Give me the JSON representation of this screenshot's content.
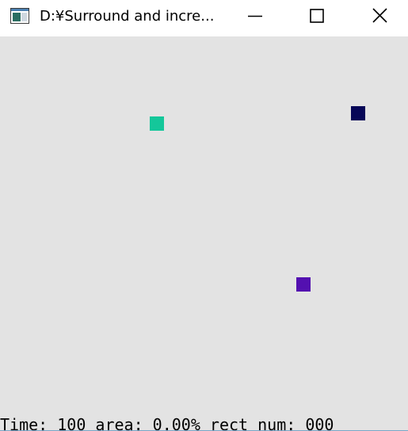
{
  "window": {
    "title": "D:¥Surround and incre..."
  },
  "icons": {
    "app": "app-window-icon",
    "minimize": "minimize-icon",
    "maximize": "maximize-icon",
    "close": "close-icon"
  },
  "canvas": {
    "background": "#e3e3e3",
    "squares": [
      {
        "color": "#14c79a"
      },
      {
        "color": "#070757"
      },
      {
        "color": "#5310b0"
      }
    ]
  },
  "status": {
    "text": "Time: 100 area: 0.00% rect num: 000"
  }
}
